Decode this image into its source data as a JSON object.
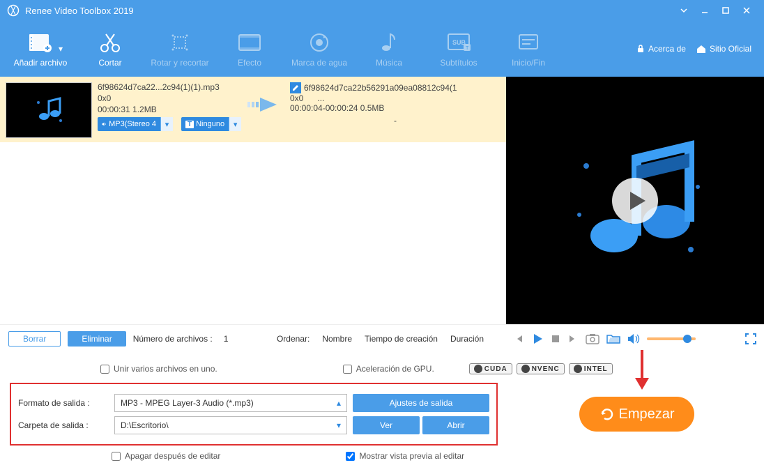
{
  "title": "Renee Video Toolbox 2019",
  "toolbar": {
    "add_file": "Añadir archivo",
    "cut": "Cortar",
    "rotate": "Rotar y recortar",
    "effect": "Efecto",
    "watermark": "Marca de agua",
    "music": "Música",
    "subtitles": "Subtítulos",
    "intro": "Inicio/Fin",
    "about": "Acerca de",
    "official": "Sitio Oficial"
  },
  "file": {
    "src_name": "6f98624d7ca22...2c94(1)(1).mp3",
    "src_dim": "0x0",
    "src_meta": "00:00:31  1.2MB",
    "dst_name": "6f98624d7ca22b56291a09ea08812c94(1",
    "dst_dim": "0x0",
    "dst_dots": "...",
    "dst_meta": "00:00:04-00:00:24  0.5MB",
    "audio_badge": "MP3(Stereo 4",
    "sub_badge": "Ninguno",
    "dash": "-"
  },
  "list_footer": {
    "clear": "Borrar",
    "delete": "Eliminar",
    "count_label": "Número de archivos :",
    "count": "1",
    "sort_label": "Ordenar:",
    "sort_name": "Nombre",
    "sort_time": "Tiempo de creación",
    "sort_duration": "Duración"
  },
  "checks": {
    "merge": "Unir varios archivos en uno.",
    "gpu": "Aceleración de GPU.",
    "cuda": "CUDA",
    "nvenc": "NVENC",
    "intel": "INTEL",
    "shutdown": "Apagar después de editar",
    "preview": "Mostrar vista previa al editar"
  },
  "form": {
    "format_label": "Formato de salida :",
    "format_value": "MP3 - MPEG Layer-3 Audio (*.mp3)",
    "settings_btn": "Ajustes de salida",
    "folder_label": "Carpeta de salida :",
    "folder_value": "D:\\Escritorio\\",
    "view_btn": "Ver",
    "open_btn": "Abrir"
  },
  "start": "Empezar"
}
